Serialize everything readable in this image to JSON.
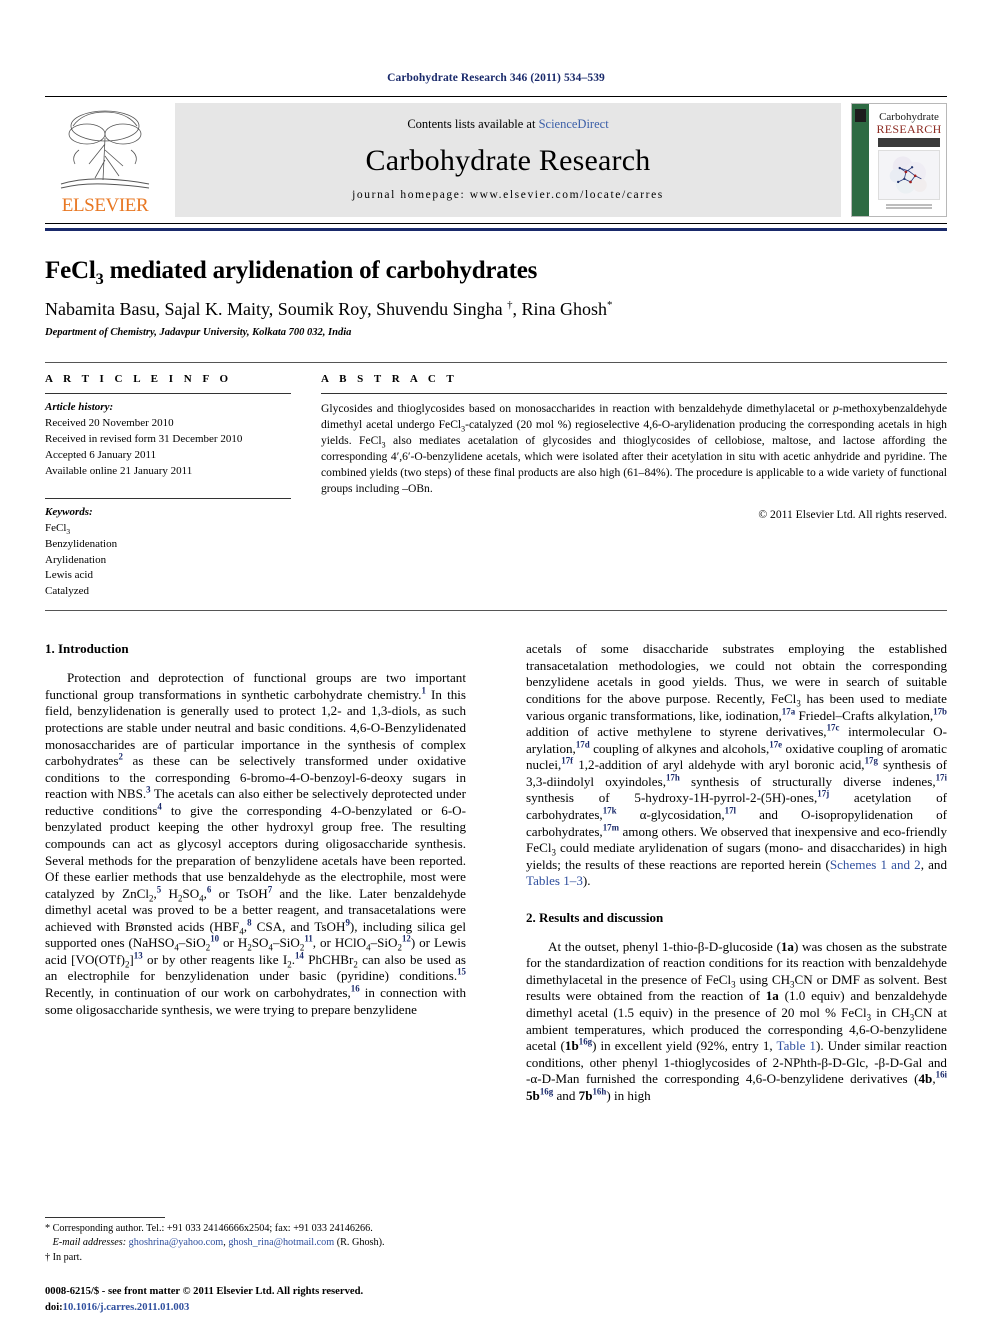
{
  "running_head": "Carbohydrate Research 346 (2011) 534–539",
  "banner": {
    "publisher": "ELSEVIER",
    "contents_prefix": "Contents lists available at ",
    "contents_link": "ScienceDirect",
    "journal_name": "Carbohydrate Research",
    "homepage": "journal homepage: www.elsevier.com/locate/carres",
    "cover": {
      "line1": "Carbohydrate",
      "line2": "RESEARCH",
      "subtitle": "An International Journal"
    }
  },
  "article": {
    "title_pre": "FeCl",
    "title_sub": "3",
    "title_post": " mediated arylidenation of carbohydrates",
    "authors": "Nabamita Basu, Sajal K. Maity, Soumik Roy, Shuvendu Singha ",
    "authors_tail": ", Rina Ghosh",
    "affiliation": "Department of Chemistry, Jadavpur University, Kolkata 700 032, India"
  },
  "info": {
    "label": "A R T I C L E    I N F O",
    "history_label": "Article history:",
    "history": [
      "Received 20 November 2010",
      "Received in revised form 31 December 2010",
      "Accepted 6 January 2011",
      "Available online 21 January 2011"
    ],
    "keywords_label": "Keywords:",
    "keywords_first_pre": "FeCl",
    "keywords_first_sub": "3",
    "keywords": [
      "Benzylidenation",
      "Arylidenation",
      "Lewis acid",
      "Catalyzed"
    ]
  },
  "abstract": {
    "label": "A B S T R A C T",
    "p1": "Glycosides and thioglycosides based on monosaccharides in reaction with benzaldehyde dimethylacetal or ",
    "p1_it": "p",
    "p2": "-methoxybenzaldehyde dimethyl acetal undergo FeCl",
    "p3": "-catalyzed (20 mol %) regioselective 4,6-O-arylidenation producing the corresponding acetals in high yields. FeCl",
    "p4": " also mediates acetalation of glycosides and thioglycosides of cellobiose, maltose, and lactose affording the corresponding 4′,6′-O-benzylidene acetals, which were isolated after their acetylation in situ with acetic anhydride and pyridine. The combined yields (two steps) of these final products are also high (61–84%). The procedure is applicable to a wide variety of functional groups including –OBn.",
    "copyright": "© 2011 Elsevier Ltd. All rights reserved."
  },
  "sections": {
    "introduction_heading": "1. Introduction",
    "results_heading": "2. Results and discussion"
  },
  "intro": {
    "t1": "Protection and deprotection of functional groups are two important functional group transformations in synthetic carbohydrate chemistry.",
    "r1": "1",
    "t2": " In this field, benzylidenation is generally used to protect 1,2- and 1,3-diols, as such protections are stable under neutral and basic conditions. 4,6-O-Benzylidenated monosaccharides are of particular importance in the synthesis of complex carbohydrates",
    "r2": "2",
    "t3": " as these can be selectively transformed under oxidative conditions to the corresponding 6-bromo-4-O-benzoyl-6-deoxy sugars in reaction with NBS.",
    "r3": "3",
    "t4": " The acetals can also either be selectively deprotected under reductive conditions",
    "r4": "4",
    "t5": " to give the corresponding 4-O-benzylated or 6-O-benzylated product keeping the other hydroxyl group free. The resulting compounds can act as glycosyl acceptors during oligosaccharide synthesis. Several methods for the preparation of benzylidene acetals have been reported. Of these earlier methods that use benzaldehyde as the electrophile, most were catalyzed by ZnCl",
    "r5": "5",
    "t6": " H",
    "r6": "6",
    "t7": " or TsOH",
    "r7": "7",
    "t8": " and the like. Later benzaldehyde dimethyl acetal was proved to be a better reagent, and transacetalations were achieved with Brønsted acids (HBF",
    "r8": "8",
    "t9": " CSA, and TsOH",
    "r9": "9",
    "t10": "), including silica gel supported ones (NaHSO",
    "r10": "10",
    "t11": " or H",
    "r11": "11",
    "t12": ", or HClO",
    "r12": "12",
    "t13": ") or Lewis acid [VO(OTf)",
    "r13": "13",
    "t14": " or by other reagents like I",
    "r14": "14",
    "t15": " PhCHBr",
    "t15b": " can also be used as an electrophile for benzylidenation under basic (pyridine) conditions.",
    "r15": "15",
    "t16": " Recently, in continuation of our work on carbohydrates,",
    "r16": "16",
    "t17": " in connection with some oligosaccharide synthesis, we were trying to prepare benzylidene"
  },
  "rightcol": {
    "t1": "acetals of some disaccharide substrates employing the established transacetalation methodologies, we could not obtain the corresponding benzylidene acetals in good yields. Thus, we were in search of suitable conditions for the above purpose. Recently, FeCl",
    "t2": " has been used to mediate various organic transformations, like, iodination,",
    "r17a": "17a",
    "t3": " Friedel–Crafts alkylation,",
    "r17b": "17b",
    "t4": " addition of active methylene to styrene derivatives,",
    "r17c": "17c",
    "t5": " intermolecular O-arylation,",
    "r17d": "17d",
    "t6": " coupling of alkynes and alcohols,",
    "r17e": "17e",
    "t7": " oxidative coupling of aromatic nuclei,",
    "r17f": "17f",
    "t8": " 1,2-addition of aryl aldehyde with aryl boronic acid,",
    "r17g": "17g",
    "t9": " synthesis of 3,3-diindolyl oxyindoles,",
    "r17h": "17h",
    "t10": " synthesis of structurally diverse indenes,",
    "r17i": "17i",
    "t11": " synthesis of 5-hydroxy-1H-pyrrol-2-(5H)-ones,",
    "r17j": "17j",
    "t12": " acetylation of carbohydrates,",
    "r17k": "17k",
    "t13": " α-glycosidation,",
    "r17l": "17l",
    "t14": " and O-isopropylidenation of carbohydrates,",
    "r17m": "17m",
    "t15": " among others. We observed that inexpensive and eco-friendly FeCl",
    "t16": " could mediate arylidenation of sugars (mono- and disaccharides) in high yields; the results of these reactions are reported herein (",
    "link_schemes": "Schemes 1 and 2",
    "t17": ", and ",
    "link_tables": "Tables 1–3",
    "t18": ").",
    "p2_t1": "At the outset, phenyl 1-thio-β-",
    "p2_sc1": "D",
    "p2_t2": "-glucoside (",
    "p2_b1": "1a",
    "p2_t3": ") was chosen as the substrate for the standardization of reaction conditions for its reaction with benzaldehyde dimethylacetal in the presence of FeCl",
    "p2_t4": " using CH",
    "p2_t5": "CN or DMF as solvent. Best results were obtained from the reaction of ",
    "p2_b2": "1a",
    "p2_t6": " (1.0 equiv) and benzaldehyde dimethyl acetal (1.5 equiv) in the presence of 20 mol % FeCl",
    "p2_t7": " in CH",
    "p2_t8": "CN at ambient temperatures, which produced the corresponding 4,6-O-benzylidene acetal (",
    "p2_b3": "1b",
    "p2_r16g": "16g",
    "p2_t9": ") in excellent yield (92%, entry 1, ",
    "p2_link": "Table 1",
    "p2_t10": "). Under similar reaction conditions, other phenyl 1-thioglycosides of 2-NPhth-β-",
    "p2_sc2": "D",
    "p2_t11": "-Glc, -β-",
    "p2_sc3": "D",
    "p2_t12": "-Gal and -α-",
    "p2_sc4": "D",
    "p2_t13": "-Man furnished the corresponding 4,6-O-benzylidene derivatives (",
    "p2_b4": "4b",
    "p2_r16i": "16i",
    "p2_b5": "5b",
    "p2_r16g2": "16g",
    "p2_t14": " and ",
    "p2_b6": "7b",
    "p2_r16h": "16h",
    "p2_t15": ") in high"
  },
  "footnotes": {
    "corresponding": "* Corresponding author. Tel.: +91 033 24146666x2504; fax: +91 033 24146266.",
    "email_label": "E-mail addresses:",
    "email1": "ghoshrina@yahoo.com",
    "email_sep": ", ",
    "email2": "ghosh_rina@hotmail.com",
    "email_tail": " (R. Ghosh).",
    "dagger": "† In part."
  },
  "imprint": {
    "line1": "0008-6215/$ - see front matter © 2011 Elsevier Ltd. All rights reserved.",
    "doi_label": "doi:",
    "doi_value": "10.1016/j.carres.2011.01.003"
  },
  "colors": {
    "journal_blue": "#1a2a6b",
    "link_blue": "#2f4f9e",
    "elsevier_orange": "#e87722",
    "cover_green": "#2e6b43",
    "banner_grey": "#e6e6e6"
  }
}
